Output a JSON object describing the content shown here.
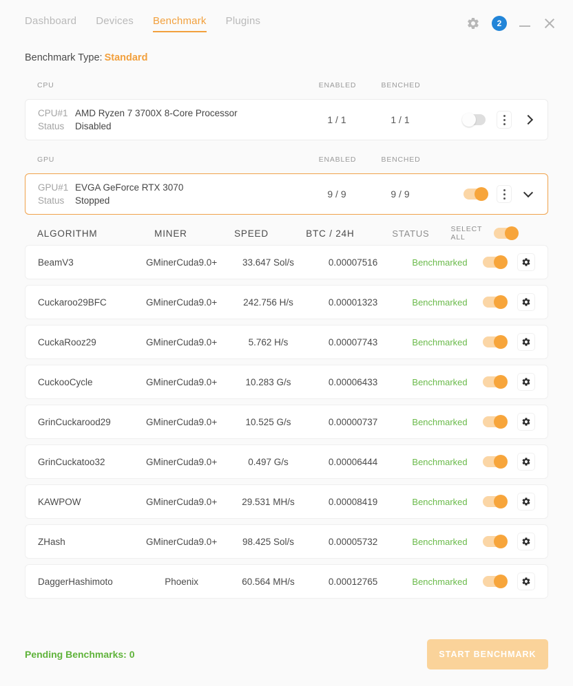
{
  "window": {
    "tabs": [
      {
        "label": "Dashboard",
        "active": false
      },
      {
        "label": "Devices",
        "active": false
      },
      {
        "label": "Benchmark",
        "active": true
      },
      {
        "label": "Plugins",
        "active": false
      }
    ],
    "settings_icon": "gear-icon",
    "notification_count": "2",
    "minimize_icon": "minimize-icon",
    "close_icon": "close-icon"
  },
  "bench_type": {
    "label": "Benchmark Type:",
    "value": "Standard"
  },
  "cpu_section": {
    "headers": {
      "name": "CPU",
      "enabled": "ENABLED",
      "benched": "BENCHED"
    },
    "device": {
      "id_key": "CPU#1",
      "name": "AMD Ryzen 7 3700X 8-Core Processor",
      "status_key": "Status",
      "status_value": "Disabled",
      "enabled": "1 / 1",
      "benched": "1 / 1",
      "toggle_state": "off",
      "menu_icon": "kebab-menu-icon",
      "expand_icon": "chevron-right-icon"
    }
  },
  "gpu_section": {
    "headers": {
      "name": "GPU",
      "enabled": "ENABLED",
      "benched": "BENCHED"
    },
    "device": {
      "id_key": "GPU#1",
      "name": "EVGA GeForce RTX 3070",
      "status_key": "Status",
      "status_value": "Stopped",
      "enabled": "9 / 9",
      "benched": "9 / 9",
      "toggle_state": "on",
      "menu_icon": "kebab-menu-icon",
      "expand_icon": "chevron-down-icon"
    }
  },
  "algo_table": {
    "headers": {
      "algorithm": "ALGORITHM",
      "miner": "MINER",
      "speed": "SPEED",
      "btc": "BTC / 24H",
      "status": "STATUS",
      "select_all": "SELECT ALL"
    },
    "select_all_state": "on",
    "rows": [
      {
        "algorithm": "BeamV3",
        "miner": "GMinerCuda9.0+",
        "speed": "33.647 Sol/s",
        "btc": "0.00007516",
        "status": "Benchmarked",
        "toggle": "on",
        "gear": "gear-icon"
      },
      {
        "algorithm": "Cuckaroo29BFC",
        "miner": "GMinerCuda9.0+",
        "speed": "242.756 H/s",
        "btc": "0.00001323",
        "status": "Benchmarked",
        "toggle": "on",
        "gear": "gear-icon"
      },
      {
        "algorithm": "CuckaRooz29",
        "miner": "GMinerCuda9.0+",
        "speed": "5.762 H/s",
        "btc": "0.00007743",
        "status": "Benchmarked",
        "toggle": "on",
        "gear": "gear-icon"
      },
      {
        "algorithm": "CuckooCycle",
        "miner": "GMinerCuda9.0+",
        "speed": "10.283 G/s",
        "btc": "0.00006433",
        "status": "Benchmarked",
        "toggle": "on",
        "gear": "gear-icon"
      },
      {
        "algorithm": "GrinCuckarood29",
        "miner": "GMinerCuda9.0+",
        "speed": "10.525 G/s",
        "btc": "0.00000737",
        "status": "Benchmarked",
        "toggle": "on",
        "gear": "gear-icon"
      },
      {
        "algorithm": "GrinCuckatoo32",
        "miner": "GMinerCuda9.0+",
        "speed": "0.497 G/s",
        "btc": "0.00006444",
        "status": "Benchmarked",
        "toggle": "on",
        "gear": "gear-icon"
      },
      {
        "algorithm": "KAWPOW",
        "miner": "GMinerCuda9.0+",
        "speed": "29.531 MH/s",
        "btc": "0.00008419",
        "status": "Benchmarked",
        "toggle": "on",
        "gear": "gear-icon"
      },
      {
        "algorithm": "ZHash",
        "miner": "GMinerCuda9.0+",
        "speed": "98.425 Sol/s",
        "btc": "0.00005732",
        "status": "Benchmarked",
        "toggle": "on",
        "gear": "gear-icon"
      },
      {
        "algorithm": "DaggerHashimoto",
        "miner": "Phoenix",
        "speed": "60.564 MH/s",
        "btc": "0.00012765",
        "status": "Benchmarked",
        "toggle": "on",
        "gear": "gear-icon"
      }
    ]
  },
  "footer": {
    "pending": "Pending Benchmarks: 0",
    "start_button": "START BENCHMARK"
  },
  "colors": {
    "accent": "#f2a03d",
    "accent_light": "#fad39a",
    "status_green": "#6aba4a",
    "badge_blue": "#2285d8",
    "muted": "#b9b9b9",
    "page_bg": "#fafafa"
  }
}
